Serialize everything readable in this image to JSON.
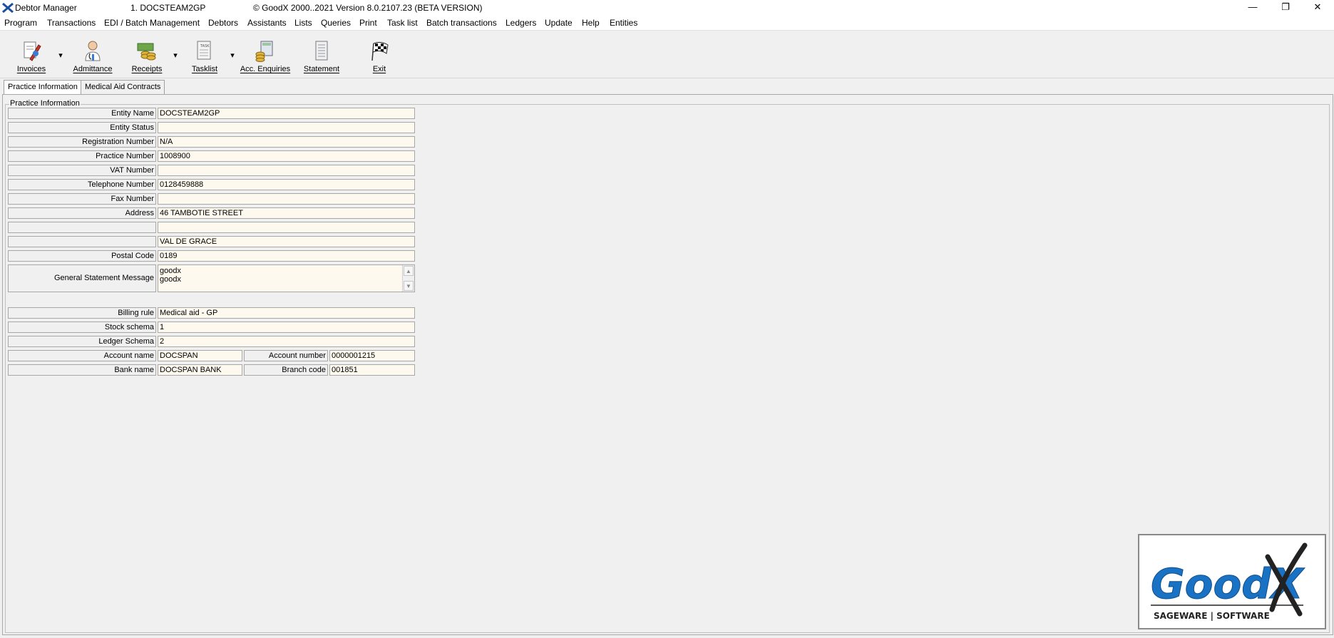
{
  "window": {
    "app_name": "Debtor Manager",
    "entity": "1. DOCSTEAM2GP",
    "copyright": "© GoodX 2000..2021  Version 8.0.2107.23 (BETA VERSION)",
    "minimize": "—",
    "restore": "❐",
    "close": "✕"
  },
  "menu": [
    "Program",
    "Transactions",
    "EDI / Batch Management",
    "Debtors",
    "Assistants",
    "Lists",
    "Queries",
    "Print",
    "Task list",
    "Batch transactions",
    "Ledgers",
    "Update",
    "Help",
    "Entities"
  ],
  "toolbar": {
    "invoices": "Invoices",
    "admittance": "Admittance",
    "receipts": "Receipts",
    "tasklist": "Tasklist",
    "acc_enquiries": "Acc. Enquiries",
    "statement": "Statement",
    "exit": "Exit",
    "dropdown_glyph": "▾"
  },
  "tabs": {
    "practice_information": "Practice Information",
    "medical_aid_contracts": "Medical Aid Contracts"
  },
  "group_title": "Practice Information",
  "fields": {
    "entity_name": {
      "label": "Entity Name",
      "value": "DOCSTEAM2GP"
    },
    "entity_status": {
      "label": "Entity Status",
      "value": ""
    },
    "registration_number": {
      "label": "Registration Number",
      "value": "N/A"
    },
    "practice_number": {
      "label": "Practice Number",
      "value": "1008900"
    },
    "vat_number": {
      "label": "VAT Number",
      "value": ""
    },
    "telephone_number": {
      "label": "Telephone Number",
      "value": "0128459888"
    },
    "fax_number": {
      "label": "Fax Number",
      "value": ""
    },
    "address": {
      "label": "Address",
      "value": "46 TAMBOTIE STREET"
    },
    "address2": {
      "label": "",
      "value": ""
    },
    "address3": {
      "label": "",
      "value": "VAL DE GRACE"
    },
    "postal_code": {
      "label": "Postal Code",
      "value": "0189"
    },
    "statement_message": {
      "label": "General Statement Message",
      "line1": "goodx",
      "line2": "goodx"
    },
    "billing_rule": {
      "label": "Billing rule",
      "value": "Medical aid - GP"
    },
    "stock_schema": {
      "label": "Stock schema",
      "value": "1"
    },
    "ledger_schema": {
      "label": "Ledger Schema",
      "value": "2"
    },
    "account_name": {
      "label": "Account name",
      "value": "DOCSPAN"
    },
    "account_number": {
      "label": "Account number",
      "value": "0000001215"
    },
    "bank_name": {
      "label": "Bank name",
      "value": "DOCSPAN BANK"
    },
    "branch_code": {
      "label": "Branch code",
      "value": "001851"
    }
  },
  "logo": {
    "brand": "GoodX",
    "tagline": "SAGEWARE | SOFTWARE"
  },
  "colors": {
    "field_bg": "#fdf9ee",
    "logo_blue": "#1a72c4"
  }
}
